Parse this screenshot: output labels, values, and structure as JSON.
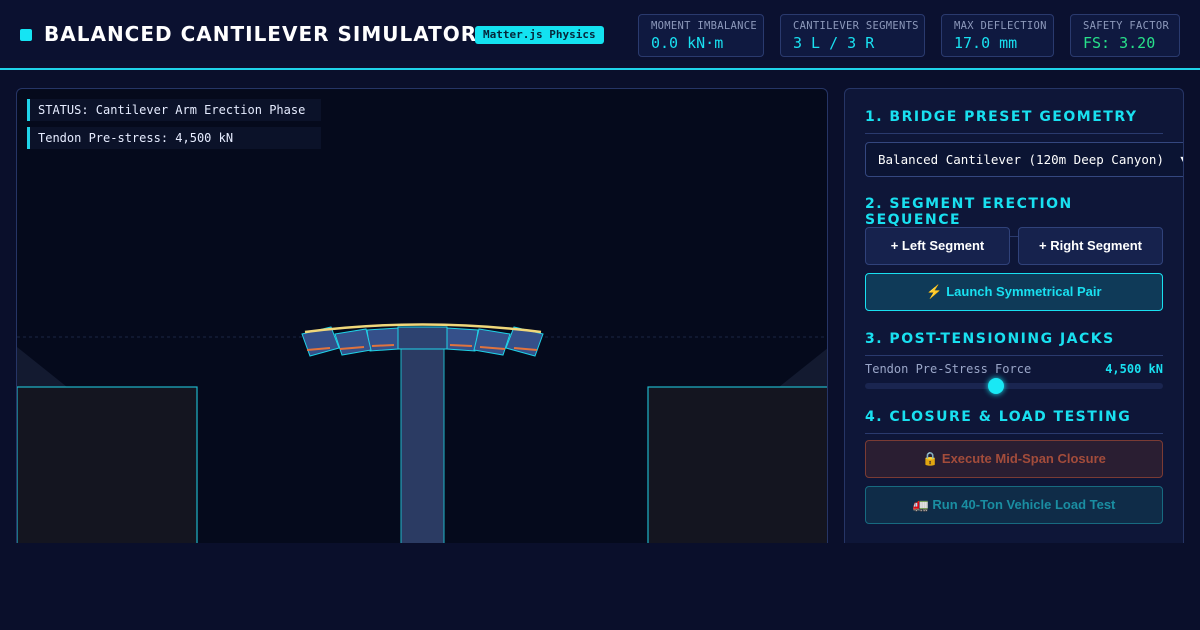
{
  "header": {
    "title": "BALANCED CANTILEVER SIMULATOR",
    "engine_badge": "Matter.js Physics",
    "stats": [
      {
        "label": "MOMENT IMBALANCE",
        "value": "0.0 kN·m"
      },
      {
        "label": "CANTILEVER SEGMENTS",
        "value": "3 L / 3 R"
      },
      {
        "label": "MAX DEFLECTION",
        "value": "17.0 mm"
      },
      {
        "label": "SAFETY FACTOR",
        "value": "FS: 3.20"
      }
    ]
  },
  "canvas": {
    "status": "STATUS: Cantilever Arm Erection Phase",
    "prestress": "Tendon Pre-stress: 4,500 kN"
  },
  "panel": {
    "section1": {
      "title": "1. BRIDGE PRESET GEOMETRY",
      "selected_option": "Balanced Cantilever (120m Deep Canyon)"
    },
    "section2": {
      "title": "2. SEGMENT ERECTION SEQUENCE",
      "left_button": "+ Left Segment",
      "right_button": "+ Right Segment",
      "launch_button": "⚡ Launch Symmetrical Pair"
    },
    "section3": {
      "title": "3. POST-TENSIONING JACKS",
      "slider_label": "Tendon Pre-Stress Force",
      "slider_value": "4,500 kN",
      "slider_fraction": 0.44
    },
    "section4": {
      "title": "4. CLOSURE & LOAD TESTING",
      "closure_button": "🔒 Execute Mid-Span Closure",
      "load_button": "🚛 Run 40-Ton Vehicle Load Test"
    }
  },
  "colors": {
    "accent": "#19e0f0",
    "background": "#0a0f2b",
    "safe": "#27e08a",
    "warning": "#a34c3b"
  }
}
